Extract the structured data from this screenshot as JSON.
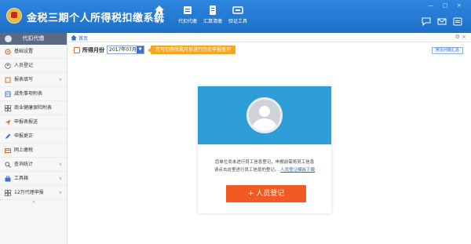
{
  "header": {
    "title": "金税三期个人所得税扣缴系统",
    "nav": [
      {
        "label": "首页",
        "icon": "home-icon"
      },
      {
        "label": "代扣代缴",
        "icon": "withholding-icon"
      },
      {
        "label": "汇算清缴",
        "icon": "settlement-icon"
      },
      {
        "label": "验证工具",
        "icon": "tools-icon"
      }
    ],
    "window_controls": {
      "min": "—",
      "max": "□",
      "close": "×"
    },
    "right_icons": [
      "chat-icon",
      "mail-icon",
      "menu-icon"
    ],
    "colors": {
      "bar": "#1d6fc7"
    }
  },
  "sidebar": {
    "title": "代扣代缴",
    "items": [
      {
        "label": "基础设置",
        "icon": "settings-icon",
        "expandable": false
      },
      {
        "label": "人员登记",
        "icon": "person-icon",
        "expandable": false
      },
      {
        "label": "报表填写",
        "icon": "form-icon",
        "expandable": true
      },
      {
        "label": "减免事项附表",
        "icon": "table-icon",
        "expandable": false
      },
      {
        "label": "商业健康保险附表",
        "icon": "grid-icon",
        "expandable": false
      },
      {
        "label": "申报表报送",
        "icon": "send-icon",
        "expandable": false
      },
      {
        "label": "申报更正",
        "icon": "edit-icon",
        "expandable": false
      },
      {
        "label": "网上缴税",
        "icon": "pay-icon",
        "expandable": false
      },
      {
        "label": "查询统计",
        "icon": "search-icon",
        "expandable": true
      },
      {
        "label": "工具箱",
        "icon": "toolbox-icon",
        "expandable": true
      },
      {
        "label": "12万代理申报",
        "icon": "agent-icon",
        "expandable": true
      }
    ],
    "collapse": "«"
  },
  "breadcrumb": {
    "label": "首页"
  },
  "filter": {
    "label": "所得月份",
    "value": "2017年07月",
    "tip": "您可切换所属月份进行历史申报查询",
    "faq_label": "常见问题汇总"
  },
  "card": {
    "text_line1": "您单位尚未进行员工信息登记，申报前需将员工信息",
    "text_line2": "请点击这里进行员工信息的登记。",
    "link": "人员登记模板下载",
    "button": "+ 人员登记"
  }
}
